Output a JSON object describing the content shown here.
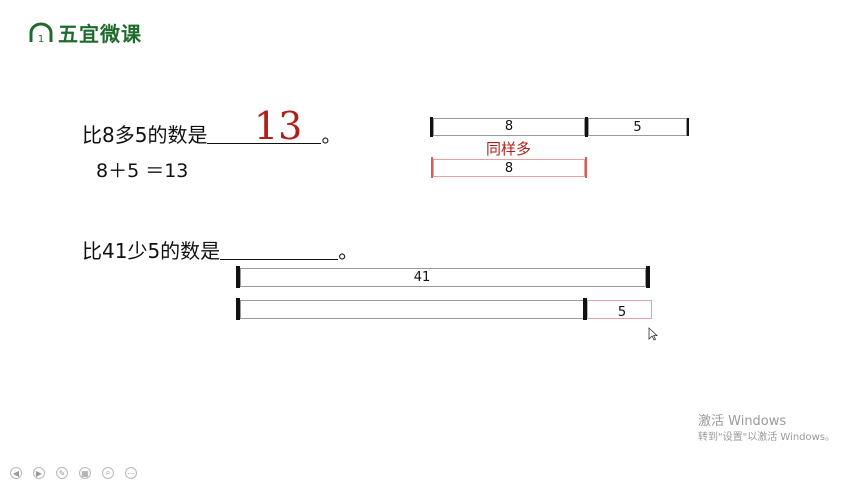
{
  "brand": {
    "name": "五宜微课",
    "logo_icon": "logo-arch-icon"
  },
  "problem1": {
    "question": "比8多5的数是",
    "end_mark": "。",
    "answer": "13",
    "equation": "8＋5  ＝13"
  },
  "diagram1": {
    "top_bar": {
      "left_label": "8",
      "right_label": "5"
    },
    "same_text": "同样多",
    "bottom_bar": {
      "label": "8"
    }
  },
  "problem2": {
    "question": "比41少5的数是",
    "end_mark": "。"
  },
  "diagram2": {
    "top_bar": {
      "label": "41"
    },
    "bottom_bar": {
      "right_label": "5"
    }
  },
  "watermark": {
    "line1": "激活 Windows",
    "line2": "转到\"设置\"以激活 Windows。"
  },
  "controls": [
    {
      "name": "prev-control",
      "glyph": "◀"
    },
    {
      "name": "next-control",
      "glyph": "▶"
    },
    {
      "name": "pen-control",
      "glyph": "✎"
    },
    {
      "name": "slides-control",
      "glyph": "▦"
    },
    {
      "name": "zoom-control",
      "glyph": "⌕"
    },
    {
      "name": "more-control",
      "glyph": "⋯"
    }
  ],
  "colors": {
    "brand_green": "#1f6b2c",
    "answer_red": "#b0201b",
    "bar_gray": "#9a9a9a",
    "bar_red": "#e3a3a3"
  }
}
